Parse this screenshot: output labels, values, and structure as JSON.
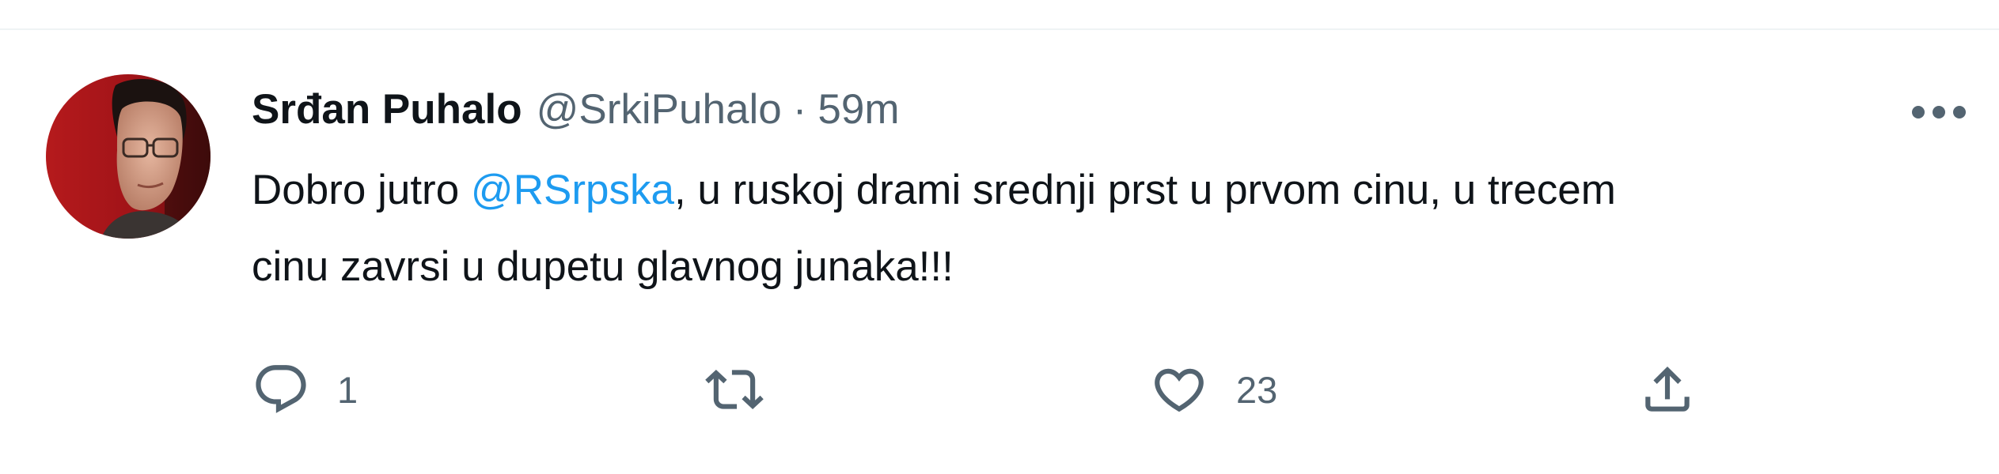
{
  "tweet": {
    "author": {
      "display_name": "Srđan Puhalo",
      "handle": "@SrkiPuhalo"
    },
    "separator": "·",
    "timestamp": "59m",
    "text": {
      "part1": "Dobro jutro ",
      "mention": "@RSrpska",
      "part2": ", u ruskoj drami srednji prst u prvom cinu, u trecem",
      "line2": "cinu zavrsi u dupetu glavnog junaka!!!"
    },
    "actions": {
      "reply_count": "1",
      "retweet_count": "",
      "like_count": "23"
    },
    "icons": {
      "more": "more-horizontal-icon",
      "reply": "reply-icon",
      "retweet": "retweet-icon",
      "like": "heart-icon",
      "share": "share-icon"
    },
    "colors": {
      "accent": "#1d9bf0",
      "secondary_text": "#536471",
      "primary_text": "#0f1419"
    }
  }
}
